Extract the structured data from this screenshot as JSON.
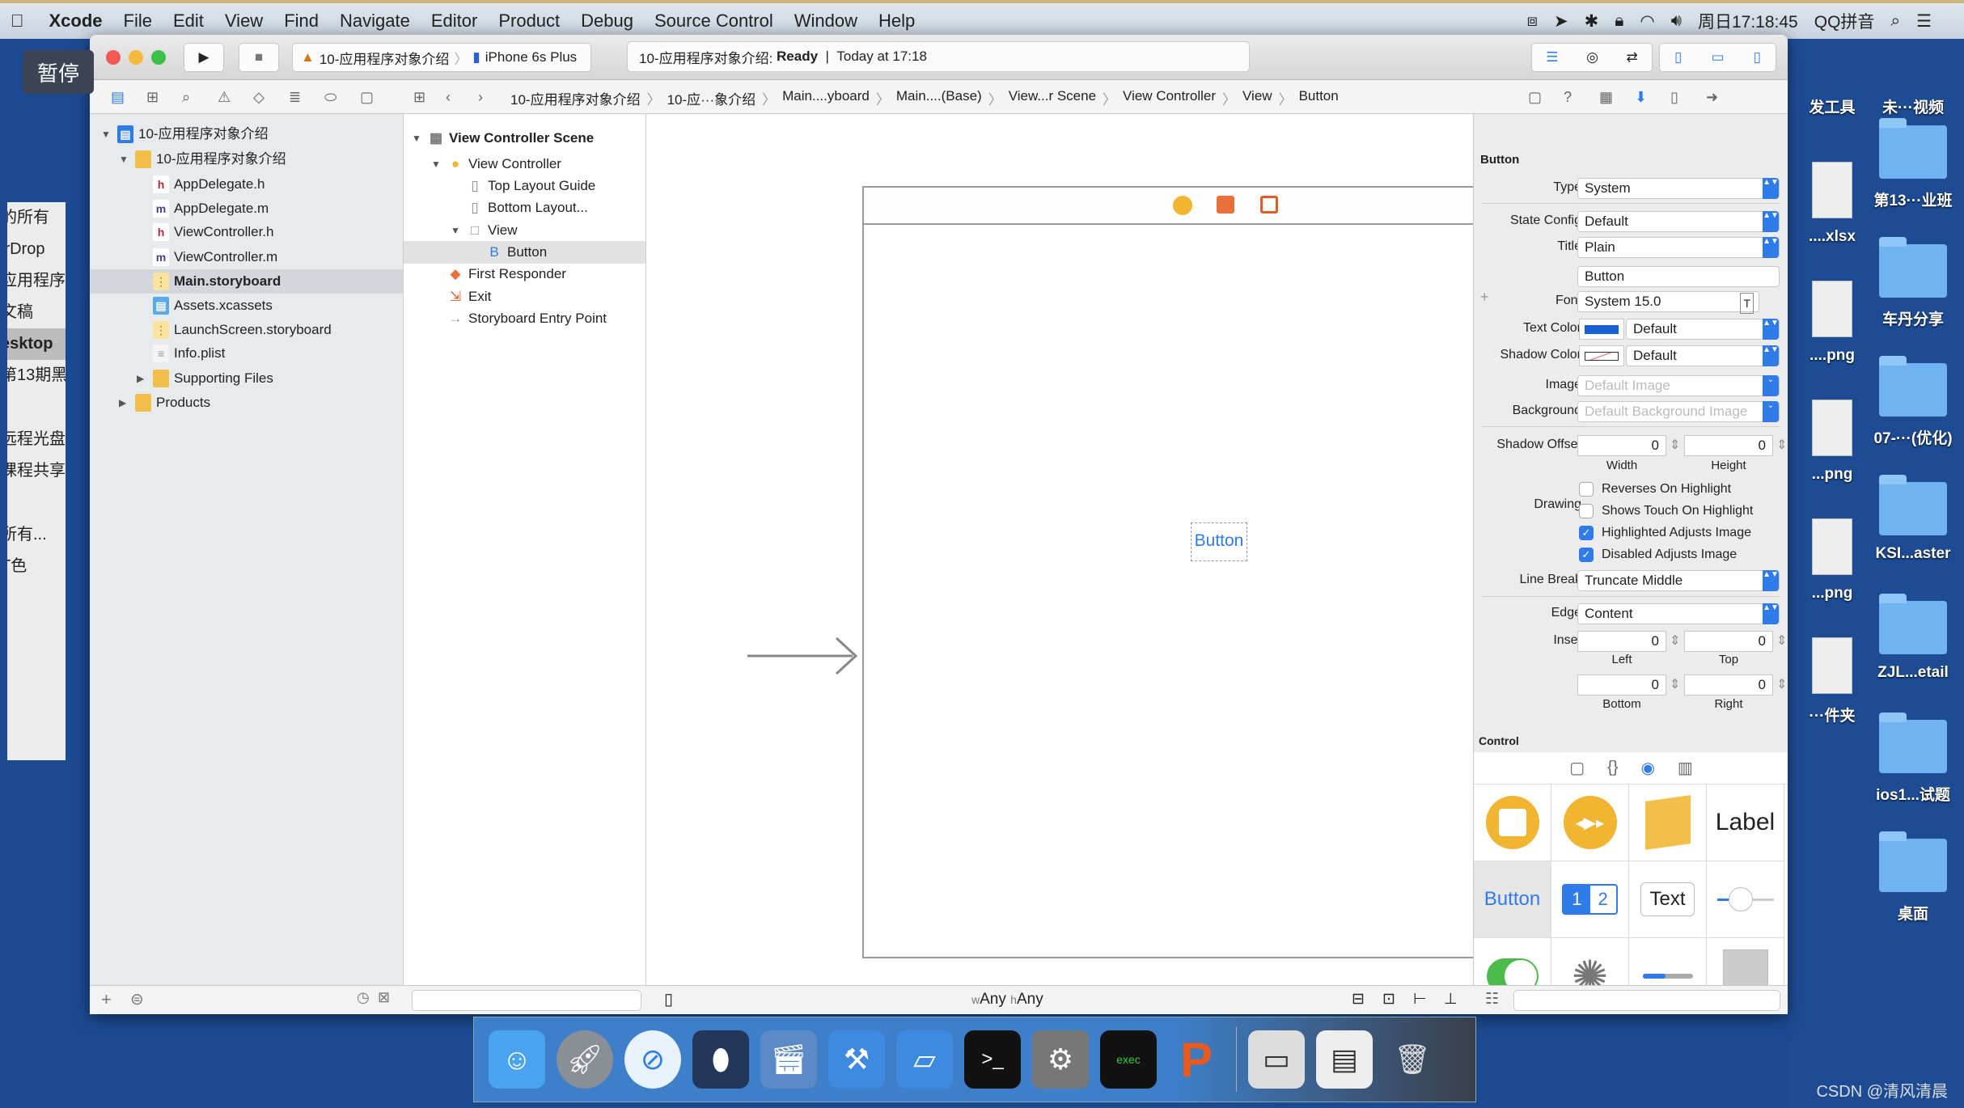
{
  "menubar": {
    "app": "Xcode",
    "items": [
      "File",
      "Edit",
      "View",
      "Find",
      "Navigate",
      "Editor",
      "Product",
      "Debug",
      "Source Control",
      "Window",
      "Help"
    ],
    "clock": "周日17:18:45",
    "input_method": "QQ拼音"
  },
  "overlay": {
    "pause": "暂停"
  },
  "finder_sidebar": [
    "的所有",
    "irDrop",
    "应用程序",
    "文稿",
    "esktop",
    "第13期黑",
    "远程光盘",
    "课程共享",
    "所有...",
    "T色"
  ],
  "toolbar": {
    "scheme": "10-应用程序对象介绍",
    "device": "iPhone 6s Plus",
    "activity_project": "10-应用程序对象介绍:",
    "activity_status": "Ready",
    "activity_time": "Today at 17:18"
  },
  "breadcrumbs": [
    "10-应用程序对象介绍",
    "10-应···象介绍",
    "Main....yboard",
    "Main....(Base)",
    "View...r Scene",
    "View Controller",
    "View",
    "Button"
  ],
  "navigator": {
    "items": [
      {
        "label": "10-应用程序对象介绍",
        "icon": "project",
        "depth": 0,
        "disclosure": "open"
      },
      {
        "label": "10-应用程序对象介绍",
        "icon": "folder",
        "depth": 1,
        "disclosure": "open"
      },
      {
        "label": "AppDelegate.h",
        "icon": "h",
        "depth": 2
      },
      {
        "label": "AppDelegate.m",
        "icon": "m",
        "depth": 2
      },
      {
        "label": "ViewController.h",
        "icon": "h",
        "depth": 2
      },
      {
        "label": "ViewController.m",
        "icon": "m",
        "depth": 2
      },
      {
        "label": "Main.storyboard",
        "icon": "storyboard",
        "depth": 2,
        "selected": true
      },
      {
        "label": "Assets.xcassets",
        "icon": "assets",
        "depth": 2
      },
      {
        "label": "LaunchScreen.storyboard",
        "icon": "storyboard",
        "depth": 2
      },
      {
        "label": "Info.plist",
        "icon": "plist",
        "depth": 2
      },
      {
        "label": "Supporting Files",
        "icon": "folder",
        "depth": 2,
        "disclosure": "closed"
      },
      {
        "label": "Products",
        "icon": "folder",
        "depth": 1,
        "disclosure": "closed"
      }
    ]
  },
  "outline": {
    "items": [
      {
        "label": "View Controller Scene",
        "depth": 0,
        "disclosure": "open",
        "bold": true
      },
      {
        "label": "View Controller",
        "depth": 1,
        "disclosure": "open"
      },
      {
        "label": "Top Layout Guide",
        "depth": 2
      },
      {
        "label": "Bottom Layout...",
        "depth": 2
      },
      {
        "label": "View",
        "depth": 2,
        "disclosure": "open"
      },
      {
        "label": "Button",
        "depth": 3,
        "selected": true
      },
      {
        "label": "First Responder",
        "depth": 1
      },
      {
        "label": "Exit",
        "depth": 1
      },
      {
        "label": "Storyboard Entry Point",
        "depth": 1
      }
    ]
  },
  "canvas": {
    "button_title": "Button",
    "size_class_w": "w",
    "size_class_w_val": "Any",
    "size_class_h": "h",
    "size_class_h_val": "Any"
  },
  "inspector": {
    "section": "Button",
    "type_label": "Type",
    "type": "System",
    "state_label": "State Config",
    "state": "Default",
    "title_label": "Title",
    "title": "Plain",
    "title_text": "Button",
    "font_label": "Font",
    "font": "System 15.0",
    "text_color_label": "Text Color",
    "text_color": "Default",
    "text_color_hex": "#1a5fd6",
    "shadow_color_label": "Shadow Color",
    "shadow_color": "Default",
    "image_label": "Image",
    "image_placeholder": "Default Image",
    "bg_label": "Background",
    "bg_placeholder": "Default Background Image",
    "shadow_offset_label": "Shadow Offset",
    "shadow_w": "0",
    "shadow_h": "0",
    "width_label": "Width",
    "height_label": "Height",
    "drawing_label": "Drawing",
    "checks": [
      {
        "label": "Reverses On Highlight",
        "checked": false
      },
      {
        "label": "Shows Touch On Highlight",
        "checked": false
      },
      {
        "label": "Highlighted Adjusts Image",
        "checked": true
      },
      {
        "label": "Disabled Adjusts Image",
        "checked": true
      }
    ],
    "line_break_label": "Line Break",
    "line_break": "Truncate Middle",
    "edge_label": "Edge",
    "edge": "Content",
    "inset_label": "Inset",
    "inset_left": "0",
    "inset_top": "0",
    "inset_bottom": "0",
    "inset_right": "0",
    "left_label": "Left",
    "top_label": "Top",
    "bottom_label": "Bottom",
    "right_label": "Right",
    "control_header": "Control"
  },
  "library": {
    "label_item": "Label",
    "button_item": "Button",
    "seg1": "1",
    "seg2": "2",
    "text_item": "Text"
  },
  "desktop": {
    "left": [
      "发工具",
      "....xlsx",
      "....png",
      "...png",
      "...png",
      "···件夹"
    ],
    "right": [
      "未···视频",
      "第13···业班",
      "车丹分享",
      "07-···(优化)",
      "KSI...aster",
      "ZJL...etail",
      "ios1...试题",
      "桌面"
    ]
  },
  "watermark": "CSDN @清风清晨"
}
